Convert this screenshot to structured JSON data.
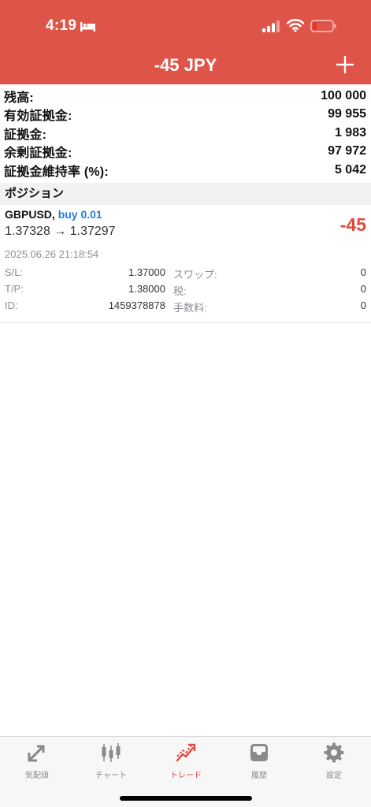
{
  "status_bar": {
    "time": "4:19"
  },
  "header": {
    "title": "-45 JPY",
    "plus_icon": "plus-icon"
  },
  "summary": [
    {
      "label": "残高:",
      "value": "100 000"
    },
    {
      "label": "有効証拠金:",
      "value": "99 955"
    },
    {
      "label": "証拠金:",
      "value": "1 983"
    },
    {
      "label": "余剰証拠金:",
      "value": "97 972"
    },
    {
      "label": "証拠金維持率 (%):",
      "value": "5 042"
    }
  ],
  "positions_section": {
    "title": "ポジション"
  },
  "position": {
    "symbol": "GBPUSD,",
    "side": "buy 0.01",
    "prices": "1.37328 → 1.37297",
    "profit": "-45",
    "datetime": "2025.06.26 21:18:54",
    "details": [
      {
        "key": "S/L:",
        "value": "1.37000",
        "key2": "スワップ:",
        "value2": "0"
      },
      {
        "key": "T/P:",
        "value": "1.38000",
        "key2": "税:",
        "value2": "0"
      },
      {
        "key": "ID:",
        "value": "1459378878",
        "key2": "手数料:",
        "value2": "0"
      }
    ]
  },
  "tabbar": {
    "tabs": [
      {
        "label": "気配値",
        "icon": "quotes-arrows-icon"
      },
      {
        "label": "チャート",
        "icon": "candlestick-chart-icon"
      },
      {
        "label": "トレード",
        "icon": "trade-trend-icon",
        "active": true
      },
      {
        "label": "履歴",
        "icon": "history-inbox-icon"
      },
      {
        "label": "設定",
        "icon": "gear-icon"
      }
    ]
  },
  "colors": {
    "header_bg": "#df5448",
    "loss": "#de4a3c",
    "buy": "#1e7de0",
    "tab_inactive": "#8a8a8a"
  }
}
